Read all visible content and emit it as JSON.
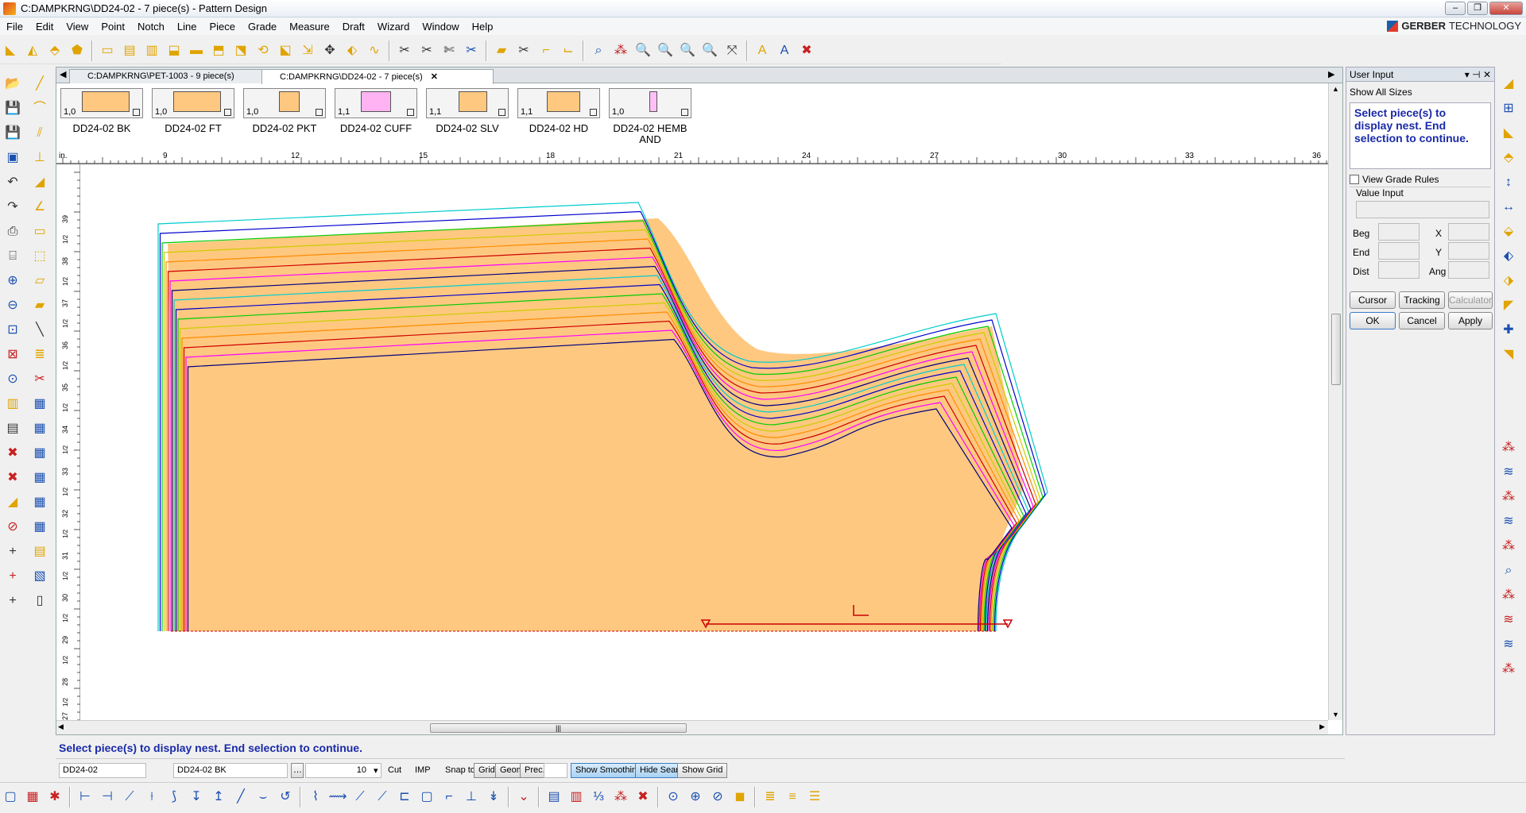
{
  "window": {
    "title": "C:DAMPKRNG\\DD24-02  - 7 piece(s) - Pattern Design"
  },
  "menu": [
    "File",
    "Edit",
    "View",
    "Point",
    "Notch",
    "Line",
    "Piece",
    "Grade",
    "Measure",
    "Draft",
    "Wizard",
    "Window",
    "Help"
  ],
  "brand": {
    "name": "GERBER",
    "suffix": "TECHNOLOGY"
  },
  "tabs": [
    {
      "label": "C:DAMPKRNG\\PET-1003  - 9 piece(s)",
      "active": false
    },
    {
      "label": "C:DAMPKRNG\\DD24-02  - 7 piece(s)",
      "active": true
    }
  ],
  "pieces": [
    {
      "scale": "1,0",
      "label": "DD24-02 BK"
    },
    {
      "scale": "1,0",
      "label": "DD24-02 FT"
    },
    {
      "scale": "1,0",
      "label": "DD24-02 PKT"
    },
    {
      "scale": "1,1",
      "label": "DD24-02 CUFF"
    },
    {
      "scale": "1,1",
      "label": "DD24-02 SLV"
    },
    {
      "scale": "1,1",
      "label": "DD24-02 HD"
    },
    {
      "scale": "1,0",
      "label": "DD24-02 HEMBAND"
    }
  ],
  "ruler": {
    "unit": "in.",
    "h_labels": [
      "9",
      "12",
      "15",
      "18",
      "21",
      "24",
      "27",
      "30",
      "33",
      "36"
    ],
    "v_labels": [
      "39",
      "38",
      "37",
      "36",
      "35",
      "34",
      "33",
      "32",
      "31",
      "30",
      "29",
      "28",
      "27"
    ],
    "half": "1/2"
  },
  "colors": {
    "piece_fill": "#ffc880",
    "sizes": [
      "#00cccc",
      "#0000cc",
      "#00cc00",
      "#cccc00",
      "#ff8c00",
      "#cc0000",
      "#ff00ff",
      "#000080"
    ]
  },
  "user_input": {
    "title": "User Input",
    "show_all_sizes": "Show All Sizes",
    "message": "Select piece(s) to display nest. End selection to continue.",
    "view_grade_rules": "View Grade Rules",
    "value_input": "Value Input",
    "fields": {
      "beg": "Beg",
      "end": "End",
      "dist": "Dist",
      "x": "X",
      "y": "Y",
      "ang": "Ang"
    },
    "buttons": {
      "cursor": "Cursor",
      "tracking": "Tracking",
      "calculator": "Calculator",
      "ok": "OK",
      "cancel": "Cancel",
      "apply": "Apply"
    }
  },
  "status": {
    "message": "Select piece(s) to display nest. End selection to continue.",
    "model": "DD24-02",
    "piece": "DD24-02 BK",
    "value": "10",
    "cut": "Cut",
    "units": "IMP",
    "snap_to": "Snap to:",
    "buttons": {
      "grid": "Grid",
      "geom": "Geom",
      "prec": "Prec.",
      "show_smoothing": "Show Smoothing",
      "hide_seams": "Hide Seams",
      "show_grid": "Show Grid"
    }
  }
}
